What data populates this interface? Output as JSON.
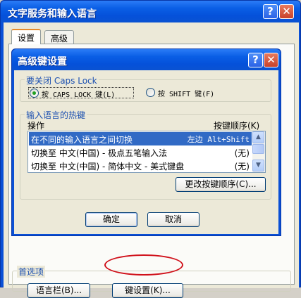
{
  "outer_window": {
    "title": "文字服务和输入语言",
    "help_glyph": "?",
    "close_glyph": "✕"
  },
  "tabs": [
    {
      "label": "设置",
      "active": true
    },
    {
      "label": "高级",
      "active": false
    }
  ],
  "inner_dialog": {
    "title": "高级键设置",
    "help_glyph": "?",
    "close_glyph": "✕",
    "caps_group": {
      "label": "要关闭 Caps Lock",
      "options": [
        {
          "label": "按 CAPS LOCK 键(L)",
          "selected": true
        },
        {
          "label": "按 SHIFT 键(F)",
          "selected": false
        }
      ]
    },
    "hotkeys_group": {
      "label": "输入语言的热键",
      "col_action": "操作",
      "col_sequence": "按键顺序(K)",
      "rows": [
        {
          "action": "在不同的输入语言之间切换",
          "keys": "左边 Alt+Shift",
          "selected": true
        },
        {
          "action": "切换至 中文(中国) - 极点五笔输入法",
          "keys": "(无)",
          "selected": false
        },
        {
          "action": "切换至 中文(中国) - 简体中文 - 美式键盘",
          "keys": "(无)",
          "selected": false
        }
      ],
      "change_button": "更改按键顺序(C)..."
    },
    "ok_button": "确定",
    "cancel_button": "取消"
  },
  "preferences": {
    "label": "首选项",
    "language_bar_button": "语言栏(B)...",
    "key_settings_button": "键设置(K)..."
  },
  "colors": {
    "title_blue": "#0a5ee5",
    "selection": "#316ac5",
    "highlight_circle": "#d0101a"
  }
}
